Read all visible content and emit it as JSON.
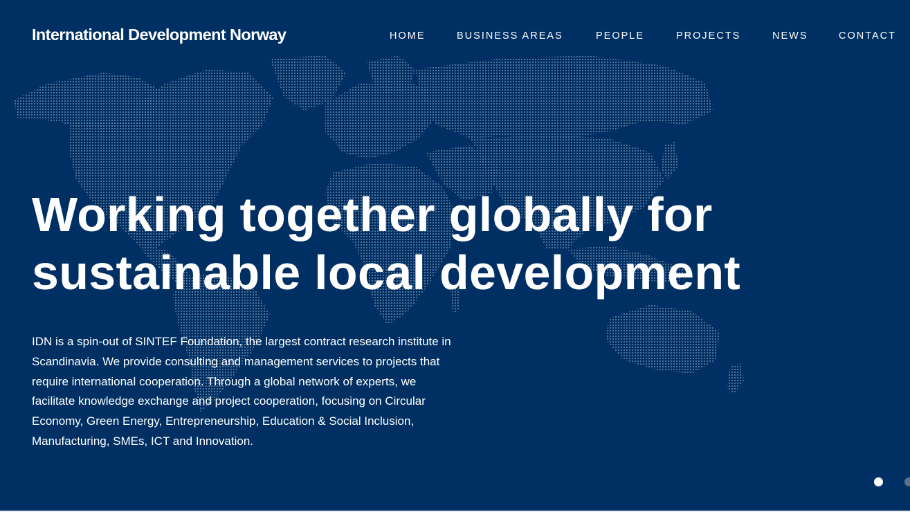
{
  "header": {
    "logo_text": "International Development Norway"
  },
  "nav": {
    "items": [
      {
        "label": "HOME"
      },
      {
        "label": "BUSINESS AREAS"
      },
      {
        "label": "PEOPLE"
      },
      {
        "label": "PROJECTS"
      },
      {
        "label": "NEWS"
      },
      {
        "label": "CONTACT"
      }
    ]
  },
  "hero": {
    "title_line1": "Working together globally for",
    "title_line2": "sustainable local development",
    "description": "IDN is a spin-out of SINTEF Foundation, the largest contract research institute in Scandinavia. We provide consulting and management services to projects that require international cooperation. Through a global network of experts, we facilitate knowledge exchange and project cooperation, focusing on Circular Economy, Green Energy, Entrepreneurship, Education & Social Inclusion, Manufacturing, SMEs, ICT and Innovation."
  },
  "slider": {
    "active_slide": 1
  },
  "colors": {
    "background": "#003063",
    "text": "#ffffff",
    "map_dots": "#8fa3bf",
    "inactive_dot": "#5f6f86"
  }
}
